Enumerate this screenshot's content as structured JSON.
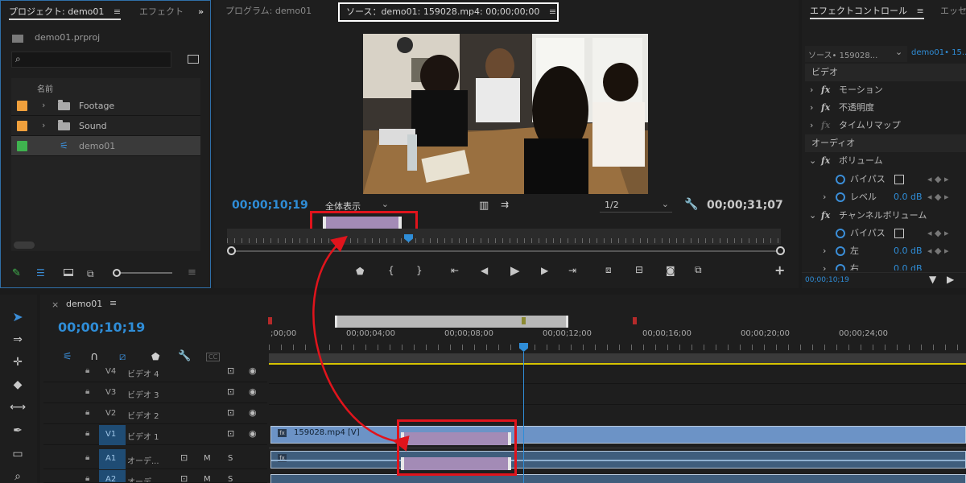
{
  "project_panel": {
    "tab_active": "プロジェクト: demo01",
    "tab_inactive": "エフェクト",
    "overflow": "»",
    "project_file": "demo01.prproj",
    "search_placeholder": "",
    "column_header": "名前",
    "items": [
      {
        "label": "Footage",
        "color": "#f0a03c",
        "kind": "folder"
      },
      {
        "label": "Sound",
        "color": "#f0a03c",
        "kind": "folder"
      },
      {
        "label": "demo01",
        "color": "#3fb34f",
        "kind": "sequence"
      }
    ]
  },
  "program_panel": {
    "program_tab": "プログラム: demo01",
    "source_tab": "ソース：demo01: 159028.mp4: 00;00;00;00",
    "timecode_current": "00;00;10;19",
    "fit_select": "全体表示",
    "resolution_select": "1/2",
    "timecode_duration": "00;00;31;07"
  },
  "effect_controls": {
    "tab_active": "エフェクトコントロール",
    "tab_inactive": "エッセ",
    "source_select": "ソース• 159028...",
    "sequence_select": "demo01• 15...",
    "section_video": "ビデオ",
    "motion": "モーション",
    "opacity": "不透明度",
    "time_remap": "タイムリマップ",
    "section_audio": "オーディオ",
    "volume": "ボリューム",
    "bypass": "バイパス",
    "level": "レベル",
    "level_value": "0.0 dB",
    "channel_volume": "チャンネルボリューム",
    "bypass2": "バイパス",
    "left": "左",
    "left_value": "0.0 dB",
    "right": "右",
    "right_value": "0.0 dB",
    "footer_timecode": "00;00;10;19"
  },
  "timeline": {
    "tab_label": "demo01",
    "timecode": "00;00;10;19",
    "ruler_labels": [
      ";00;00",
      "00;00;04;00",
      "00;00;08;00",
      "00;00;12;00",
      "00;00;16;00",
      "00;00;20;00",
      "00;00;24;00"
    ],
    "tracks": [
      {
        "id": "V4",
        "name": "ビデオ 4"
      },
      {
        "id": "V3",
        "name": "ビデオ 3"
      },
      {
        "id": "V2",
        "name": "ビデオ 2"
      },
      {
        "id": "V1",
        "name": "ビデオ 1"
      },
      {
        "id": "A1",
        "name": "オーデ..."
      },
      {
        "id": "A2",
        "name": "オーデ"
      }
    ],
    "clip_label": "159028.mp4 [V]",
    "m_label": "M",
    "s_label": "S",
    "cc_label": "CC"
  },
  "colors": {
    "accent_blue": "#2f8dd7",
    "selection_purple": "#a38bb6",
    "clip_blue": "#6c93c6",
    "highlight_red": "#e0141c"
  }
}
